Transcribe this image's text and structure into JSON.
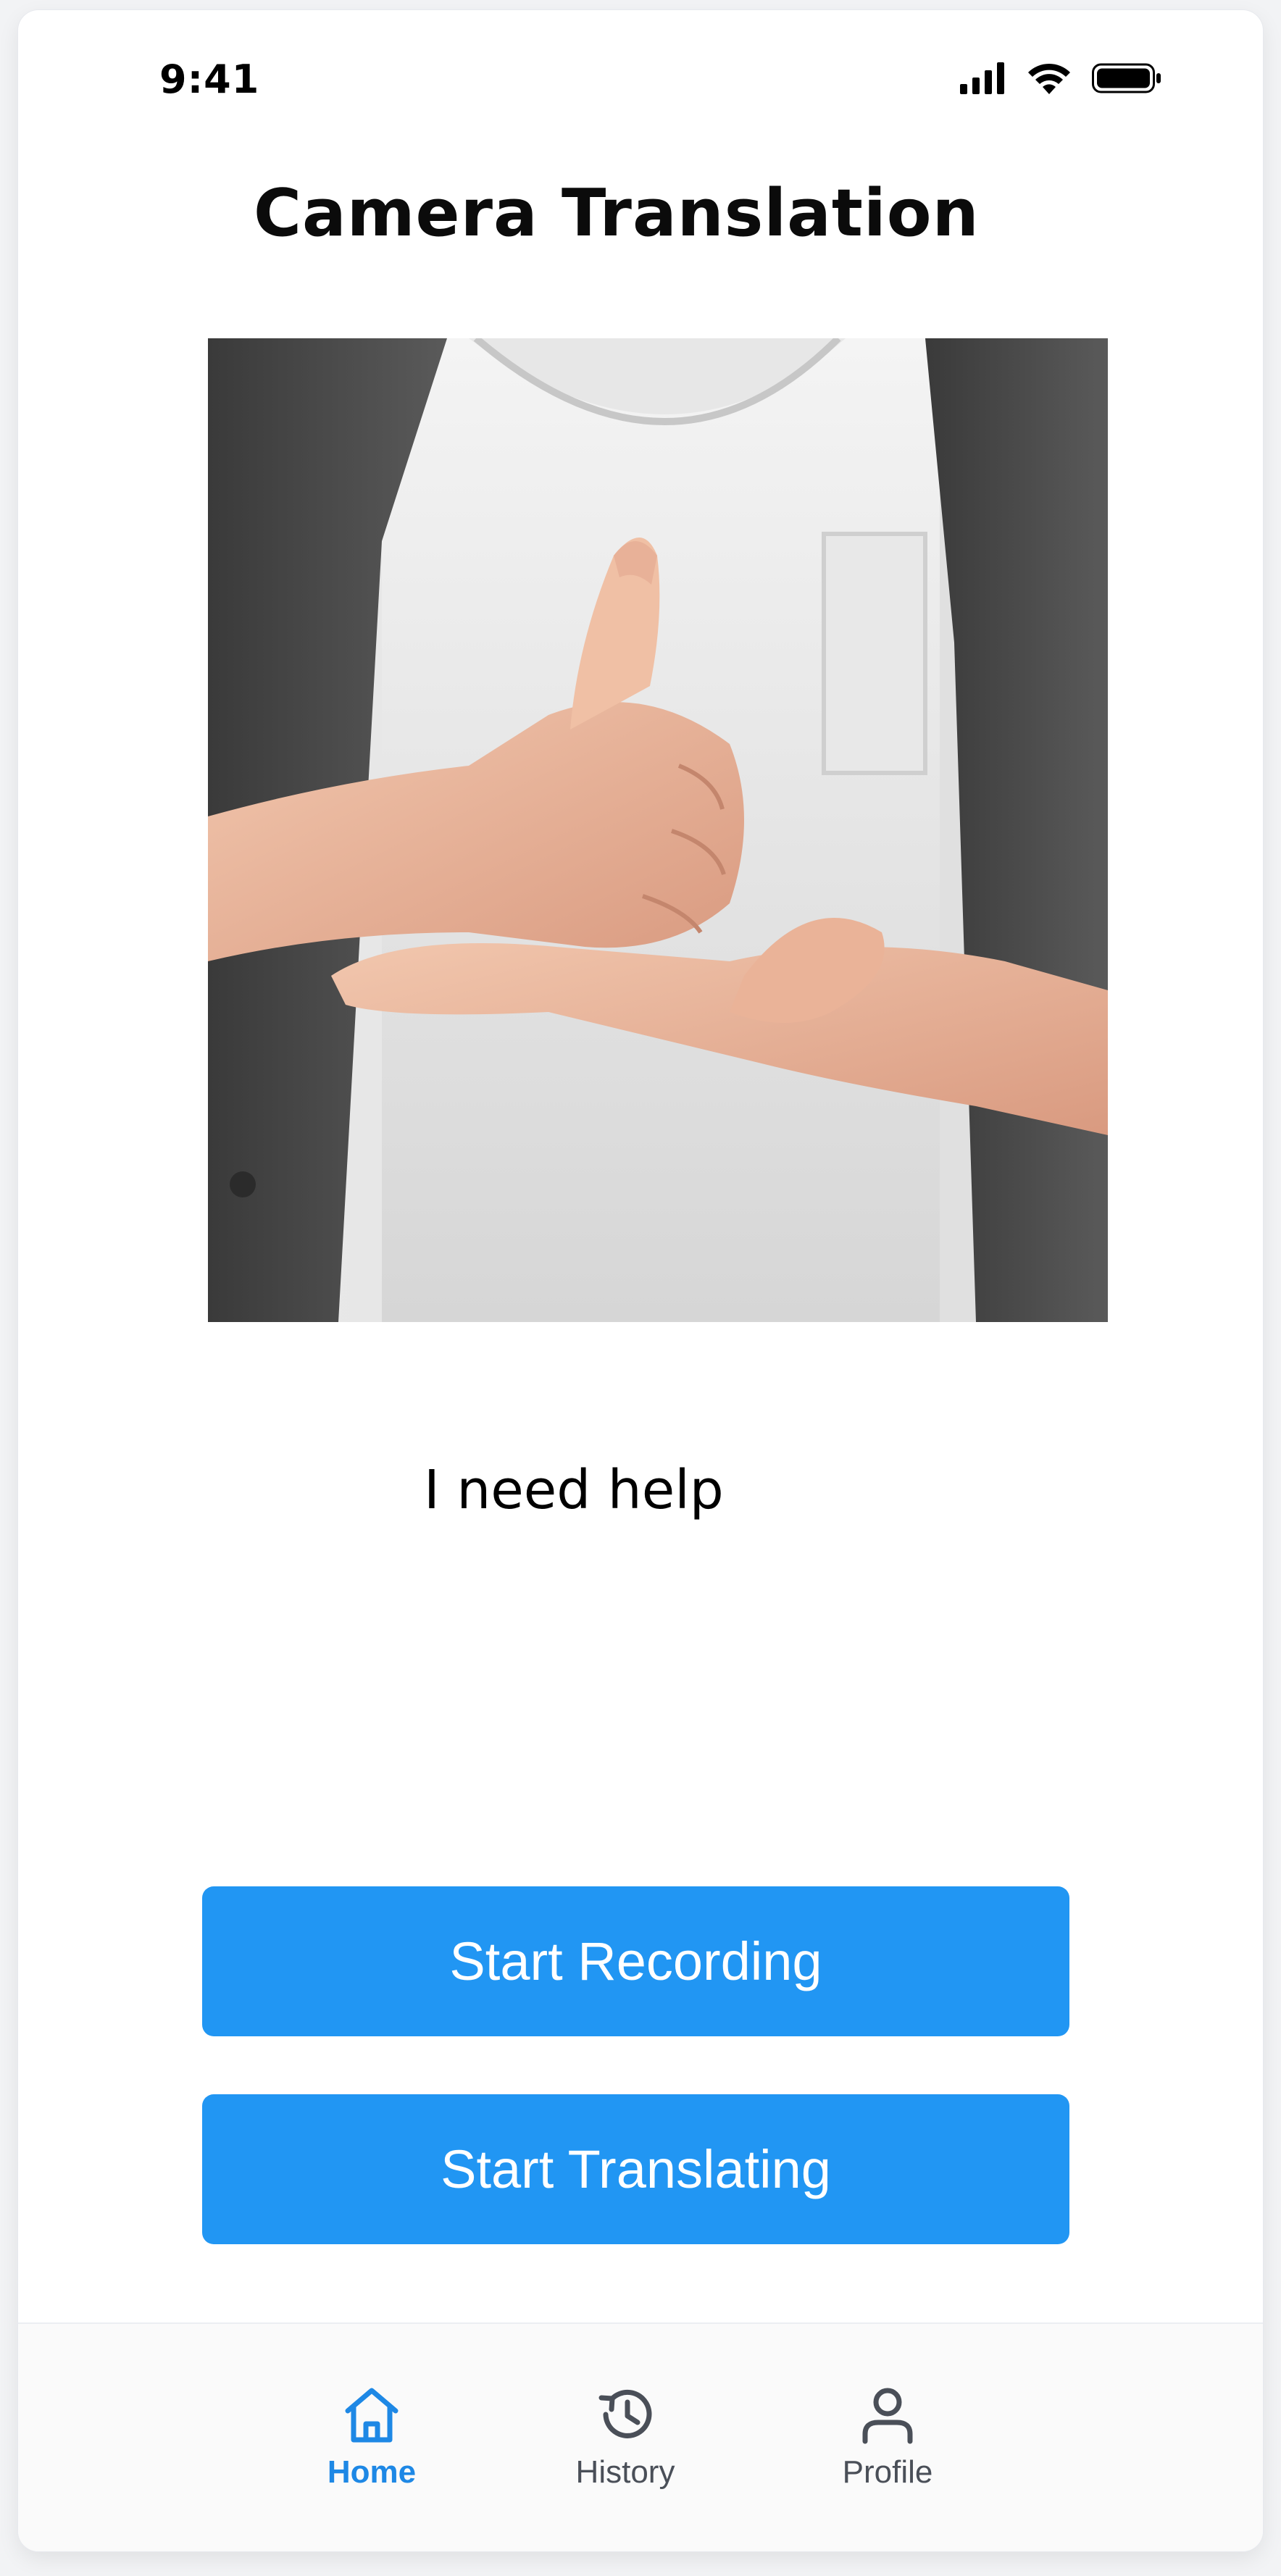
{
  "status_bar": {
    "time": "9:41"
  },
  "screen": {
    "title": "Camera Translation",
    "translation_text": "I need help"
  },
  "actions": {
    "start_recording_label": "Start Recording",
    "start_translating_label": "Start Translating"
  },
  "bottom_nav": {
    "items": [
      {
        "label": "Home",
        "icon": "home-icon",
        "active": true
      },
      {
        "label": "History",
        "icon": "history-icon",
        "active": false
      },
      {
        "label": "Profile",
        "icon": "profile-icon",
        "active": false
      }
    ]
  },
  "colors": {
    "primary": "#2196F3",
    "nav_active": "#1E88E5",
    "nav_inactive": "#4A4F58"
  },
  "camera_preview": {
    "icon": "sign-language-photo"
  }
}
